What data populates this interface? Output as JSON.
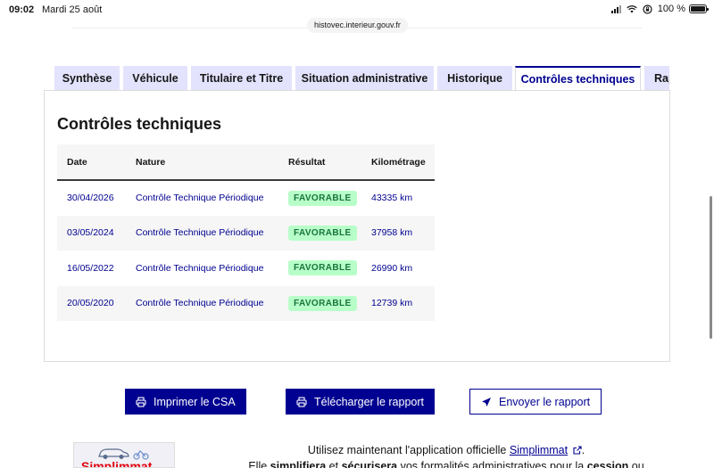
{
  "status_bar": {
    "time": "09:02",
    "date": "Mardi 25 août",
    "battery": "100 %",
    "battery_level": 1.0
  },
  "browser": {
    "url": "histovec.interieur.gouv.fr"
  },
  "tabs": [
    {
      "label": "Synthèse"
    },
    {
      "label": "Véhicule"
    },
    {
      "label": "Titulaire et Titre"
    },
    {
      "label": "Situation administrative"
    },
    {
      "label": "Historique"
    },
    {
      "label": "Contrôles techniques"
    },
    {
      "label": "Rap"
    }
  ],
  "panel": {
    "title": "Contrôles techniques",
    "columns": [
      "Date",
      "Nature",
      "Résultat",
      "Kilométrage"
    ],
    "rows": [
      {
        "date": "30/04/2026",
        "nature": "Contrôle Technique Périodique",
        "result": "FAVORABLE",
        "km": "43335 km"
      },
      {
        "date": "03/05/2024",
        "nature": "Contrôle Technique Périodique",
        "result": "FAVORABLE",
        "km": "37958 km"
      },
      {
        "date": "16/05/2022",
        "nature": "Contrôle Technique Périodique",
        "result": "FAVORABLE",
        "km": "26990 km"
      },
      {
        "date": "20/05/2020",
        "nature": "Contrôle Technique Périodique",
        "result": "FAVORABLE",
        "km": "12739 km"
      }
    ]
  },
  "actions": {
    "print": "Imprimer le CSA",
    "download": "Télécharger le rapport",
    "send": "Envoyer le rapport"
  },
  "promo": {
    "line1_before": "Utilisez maintenant l'application officielle ",
    "link": "Simplimmat",
    "line1_after": ".",
    "line2_a": "Elle ",
    "line2_b": "simplifiera",
    "line2_c": " et ",
    "line2_d": "sécurisera",
    "line2_e": " vos formalités administratives pour la ",
    "line2_f": "cession",
    "line2_g": " ou",
    "logo_text": "Simplimmat"
  },
  "colors": {
    "primary": "#000091",
    "tab_bg": "#e3e3fd",
    "success_bg": "#b8fec9",
    "success_text": "#18753c"
  }
}
